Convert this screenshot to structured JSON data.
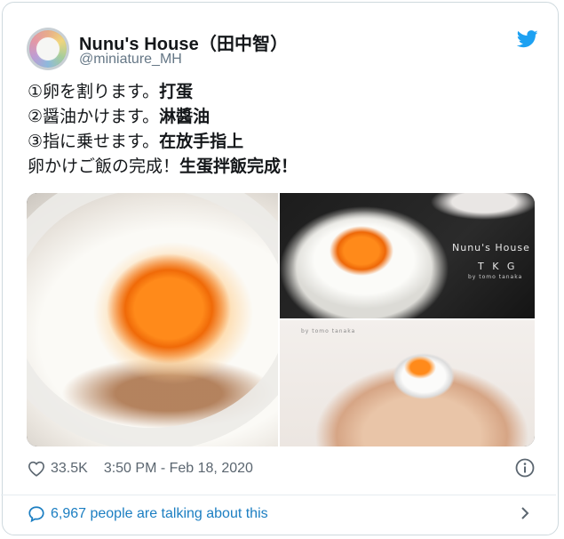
{
  "tweet": {
    "author_name": "Nunu's House（田中智）",
    "author_handle": "@miniature_MH",
    "lines": [
      {
        "text": "①卵を割ります。",
        "bold": "打蛋"
      },
      {
        "text": "②醤油かけます。",
        "bold": "淋醬油"
      },
      {
        "text": "③指に乗せます。",
        "bold": "在放手指上"
      },
      {
        "text": "卵かけご飯の完成！",
        "bold": "生蛋拌飯完成！"
      }
    ],
    "media": {
      "watermark_title": "Nunu's House",
      "watermark_sub": "T K G",
      "watermark_credit": "by tomo tanaka",
      "watermark_credit_2": "by tomo tanaka"
    },
    "likes": "33.5K",
    "timestamp": "3:50 PM - Feb 18, 2020",
    "talking": "6,967 people are talking about this"
  },
  "colors": {
    "twitter_blue": "#1da1f2",
    "link_blue": "#1b7ec2",
    "muted": "#657786"
  },
  "icons": [
    "avatar",
    "twitter-bird-icon",
    "heart-icon",
    "info-icon",
    "speech-bubble-icon",
    "chevron-right-icon"
  ]
}
